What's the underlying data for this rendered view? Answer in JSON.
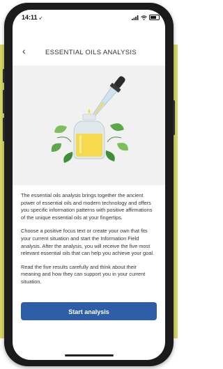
{
  "status_bar": {
    "time": "14:11",
    "location_arrow": "➶"
  },
  "nav": {
    "back_icon": "‹",
    "title": "ESSENTIAL OILS ANALYSIS"
  },
  "hero": {
    "illustration": "essential-oil-bottle-with-dropper-and-leaves"
  },
  "content": {
    "paragraphs": [
      "The essential oils analysis brings together the ancient power of essential oils and modern technology and offers you specific information patterns with positive affirmations of the unique essential oils at your fingertips.",
      "Choose a positive focus text or create your own that fits your current situation and start the Information Field analysis. After the analysis, you will receive the five most relevant essential oils that can help you achieve your goal.",
      "Read the five results carefully and think about their meaning and how they can support you in your current situation."
    ]
  },
  "cta": {
    "label": "Start analysis"
  },
  "colors": {
    "accent": "#2d5ea7",
    "backdrop": "#d5d968",
    "hero_bg": "#f1f1f1"
  }
}
